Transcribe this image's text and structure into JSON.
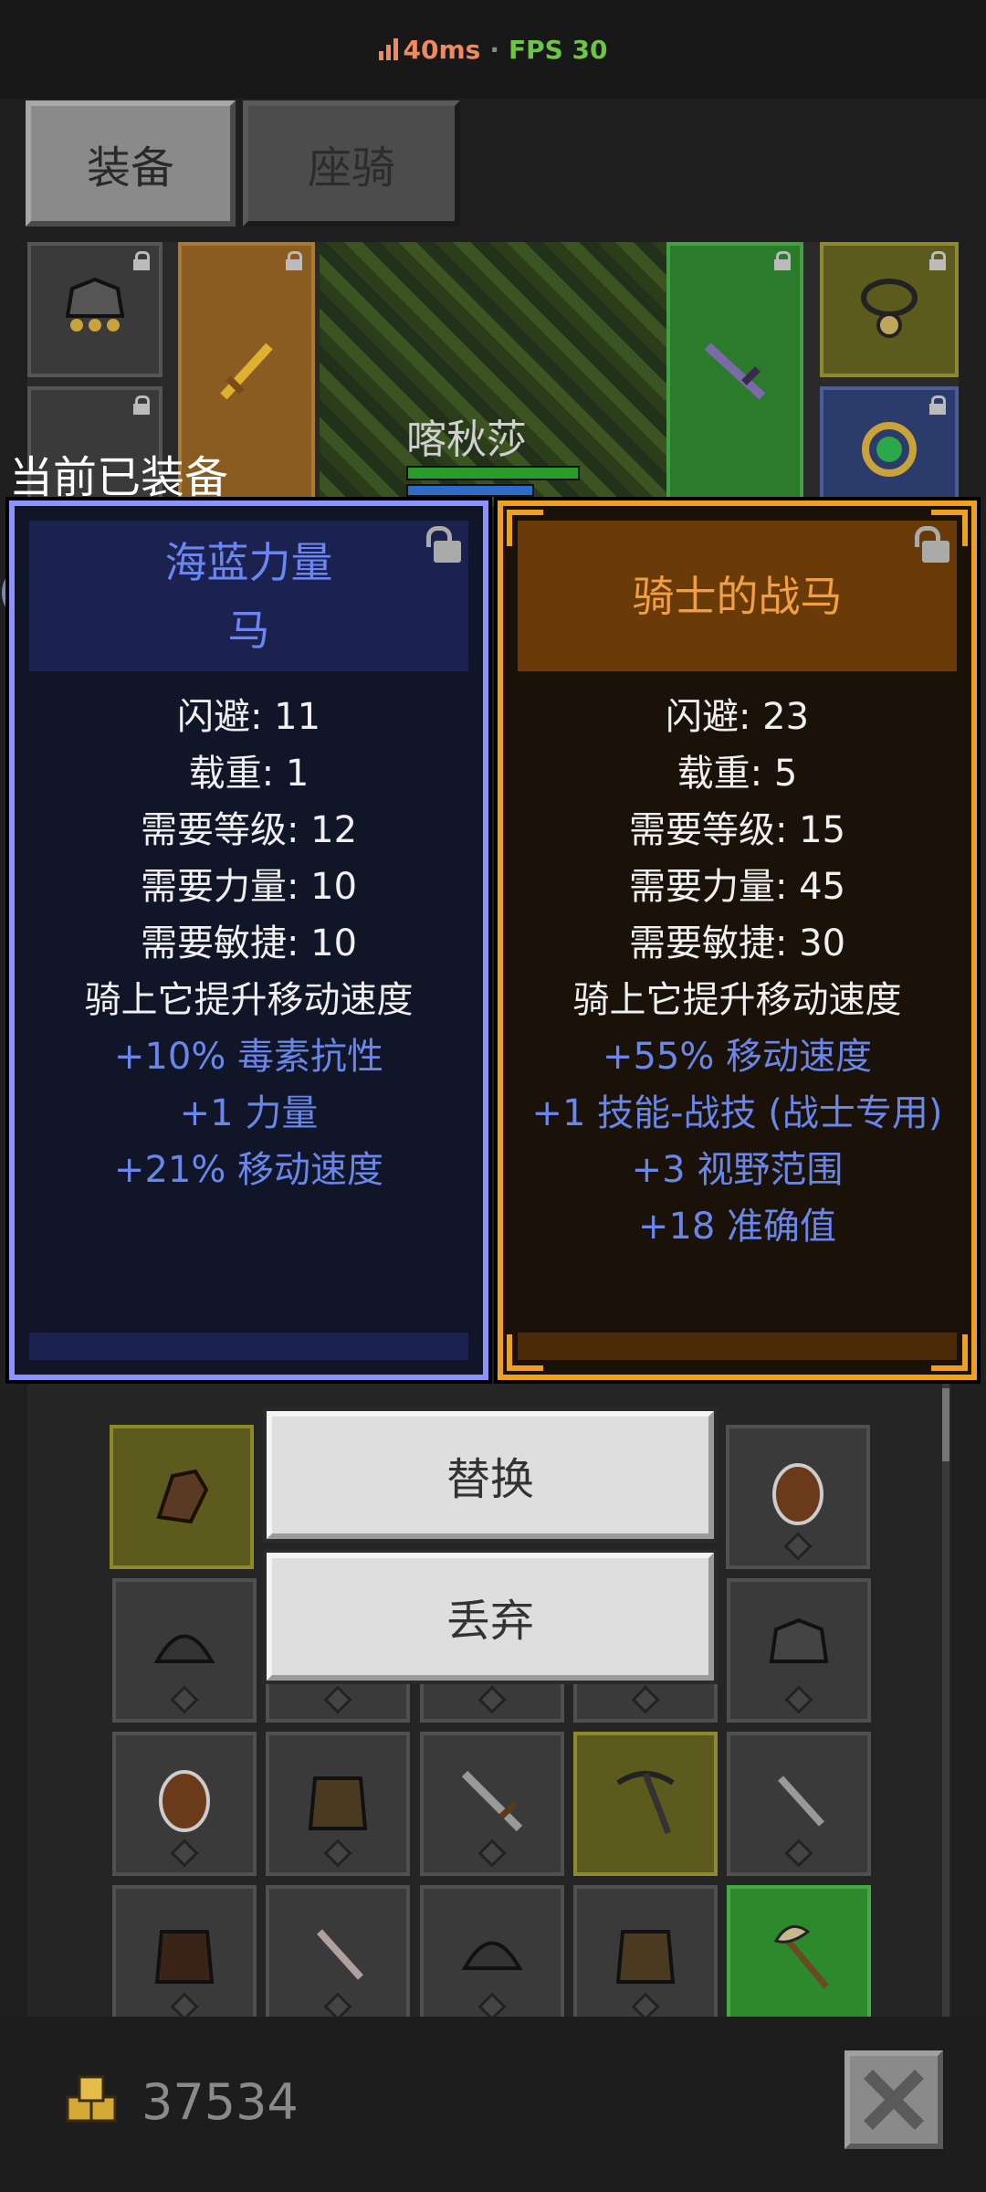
{
  "status": {
    "ping": "40ms",
    "separator": "·",
    "fps": "FPS 30"
  },
  "tabs": [
    {
      "label": "装备"
    },
    {
      "label": "座骑"
    }
  ],
  "character": {
    "name": "喀秋莎"
  },
  "current_equipped_label": "当前已装备",
  "equipped_item": {
    "name_line1": "海蓝力量",
    "name_line2": "马",
    "stats": [
      "闪避: 11",
      "载重: 1",
      "需要等级: 12",
      "需要力量: 10",
      "需要敏捷: 10",
      "骑上它提升移动速度"
    ],
    "bonuses": [
      "+10% 毒素抗性",
      "+1 力量",
      "+21% 移动速度"
    ]
  },
  "new_item": {
    "name": "骑士的战马",
    "stats": [
      "闪避: 23",
      "载重: 5",
      "需要等级: 15",
      "需要力量: 45",
      "需要敏捷: 30",
      "骑上它提升移动速度"
    ],
    "bonuses": [
      "+55% 移动速度",
      "+1 技能-战技 (战士专用)",
      "+3 视野范围",
      "+18 准确值"
    ]
  },
  "actions": {
    "replace": "替换",
    "discard": "丢弃"
  },
  "currency": {
    "gold": "37534"
  },
  "colors": {
    "blue_rarity": "#8c93ff",
    "orange_rarity": "#f0a020",
    "bonus_text": "#6a86e8"
  }
}
